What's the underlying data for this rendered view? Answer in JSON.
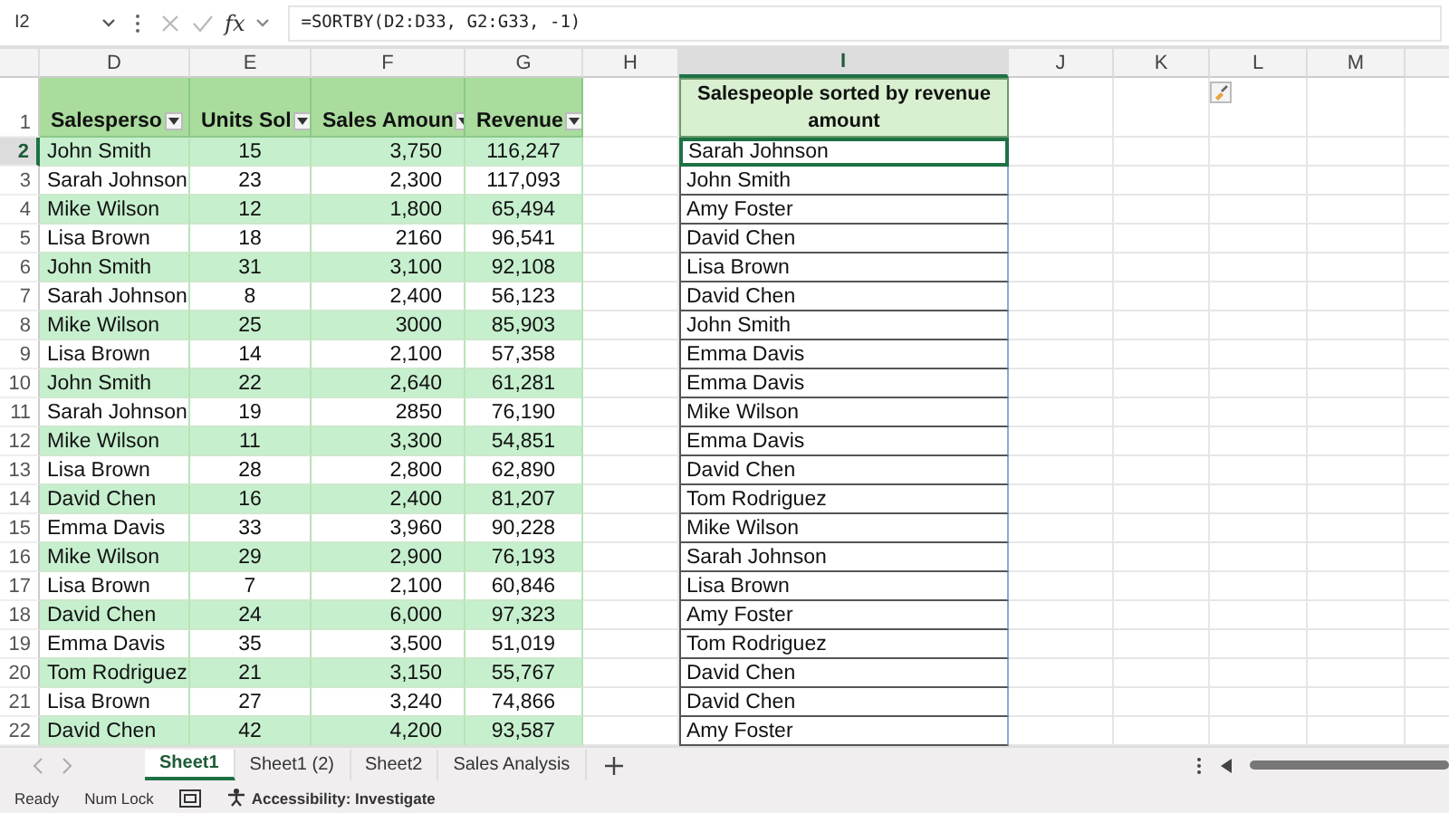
{
  "formula_bar": {
    "name_box": "I2",
    "function_label": "fx",
    "formula": "=SORTBY(D2:D33, G2:G33, -1)"
  },
  "columns": [
    {
      "letter": "D",
      "selected": false
    },
    {
      "letter": "E",
      "selected": false
    },
    {
      "letter": "F",
      "selected": false
    },
    {
      "letter": "G",
      "selected": false
    },
    {
      "letter": "H",
      "selected": false
    },
    {
      "letter": "I",
      "selected": true
    },
    {
      "letter": "J",
      "selected": false
    },
    {
      "letter": "K",
      "selected": false
    },
    {
      "letter": "L",
      "selected": false
    },
    {
      "letter": "M",
      "selected": false
    }
  ],
  "header_row": {
    "number": "1",
    "table_headers": [
      "Salesperso",
      "Units Sol",
      "Sales Amoun",
      "Revenue"
    ],
    "result_header": "Salespeople sorted by revenue amount"
  },
  "rows": [
    {
      "number": "2",
      "selected": true,
      "salesperson": "John Smith",
      "units": "15",
      "amount": "3,750",
      "revenue": "116,247",
      "sorted_name": "Sarah Johnson"
    },
    {
      "number": "3",
      "selected": false,
      "salesperson": "Sarah Johnson",
      "units": "23",
      "amount": "2,300",
      "revenue": "117,093",
      "sorted_name": "John Smith"
    },
    {
      "number": "4",
      "selected": false,
      "salesperson": "Mike Wilson",
      "units": "12",
      "amount": "1,800",
      "revenue": "65,494",
      "sorted_name": "Amy Foster"
    },
    {
      "number": "5",
      "selected": false,
      "salesperson": "Lisa Brown",
      "units": "18",
      "amount": "2160",
      "revenue": "96,541",
      "sorted_name": "David Chen"
    },
    {
      "number": "6",
      "selected": false,
      "salesperson": "John Smith",
      "units": "31",
      "amount": "3,100",
      "revenue": "92,108",
      "sorted_name": "Lisa Brown"
    },
    {
      "number": "7",
      "selected": false,
      "salesperson": "Sarah Johnson",
      "units": "8",
      "amount": "2,400",
      "revenue": "56,123",
      "sorted_name": "David Chen"
    },
    {
      "number": "8",
      "selected": false,
      "salesperson": "Mike Wilson",
      "units": "25",
      "amount": "3000",
      "revenue": "85,903",
      "sorted_name": "John Smith"
    },
    {
      "number": "9",
      "selected": false,
      "salesperson": "Lisa Brown",
      "units": "14",
      "amount": "2,100",
      "revenue": "57,358",
      "sorted_name": "Emma Davis"
    },
    {
      "number": "10",
      "selected": false,
      "salesperson": "John Smith",
      "units": "22",
      "amount": "2,640",
      "revenue": "61,281",
      "sorted_name": "Emma Davis"
    },
    {
      "number": "11",
      "selected": false,
      "salesperson": "Sarah Johnson",
      "units": "19",
      "amount": "2850",
      "revenue": "76,190",
      "sorted_name": "Mike Wilson"
    },
    {
      "number": "12",
      "selected": false,
      "salesperson": "Mike Wilson",
      "units": "11",
      "amount": "3,300",
      "revenue": "54,851",
      "sorted_name": "Emma Davis"
    },
    {
      "number": "13",
      "selected": false,
      "salesperson": "Lisa Brown",
      "units": "28",
      "amount": "2,800",
      "revenue": "62,890",
      "sorted_name": "David Chen"
    },
    {
      "number": "14",
      "selected": false,
      "salesperson": "David Chen",
      "units": "16",
      "amount": "2,400",
      "revenue": "81,207",
      "sorted_name": "Tom Rodriguez"
    },
    {
      "number": "15",
      "selected": false,
      "salesperson": "Emma Davis",
      "units": "33",
      "amount": "3,960",
      "revenue": "90,228",
      "sorted_name": "Mike Wilson"
    },
    {
      "number": "16",
      "selected": false,
      "salesperson": "Mike Wilson",
      "units": "29",
      "amount": "2,900",
      "revenue": "76,193",
      "sorted_name": "Sarah Johnson"
    },
    {
      "number": "17",
      "selected": false,
      "salesperson": "Lisa Brown",
      "units": "7",
      "amount": "2,100",
      "revenue": "60,846",
      "sorted_name": "Lisa Brown"
    },
    {
      "number": "18",
      "selected": false,
      "salesperson": "David Chen",
      "units": "24",
      "amount": "6,000",
      "revenue": "97,323",
      "sorted_name": "Amy Foster"
    },
    {
      "number": "19",
      "selected": false,
      "salesperson": "Emma Davis",
      "units": "35",
      "amount": "3,500",
      "revenue": "51,019",
      "sorted_name": "Tom Rodriguez"
    },
    {
      "number": "20",
      "selected": false,
      "salesperson": "Tom Rodriguez",
      "units": "21",
      "amount": "3,150",
      "revenue": "55,767",
      "sorted_name": "David Chen"
    },
    {
      "number": "21",
      "selected": false,
      "salesperson": "Lisa Brown",
      "units": "27",
      "amount": "3,240",
      "revenue": "74,866",
      "sorted_name": "David Chen"
    },
    {
      "number": "22",
      "selected": false,
      "salesperson": "David Chen",
      "units": "42",
      "amount": "4,200",
      "revenue": "93,587",
      "sorted_name": "Amy Foster"
    }
  ],
  "sheet_tabs": [
    {
      "label": "Sheet1",
      "selected": true
    },
    {
      "label": "Sheet1 (2)",
      "selected": false
    },
    {
      "label": "Sheet2",
      "selected": false
    },
    {
      "label": "Sales Analysis",
      "selected": false
    }
  ],
  "status_bar": {
    "mode": "Ready",
    "num_lock": "Num Lock",
    "accessibility": "Accessibility: Investigate"
  }
}
